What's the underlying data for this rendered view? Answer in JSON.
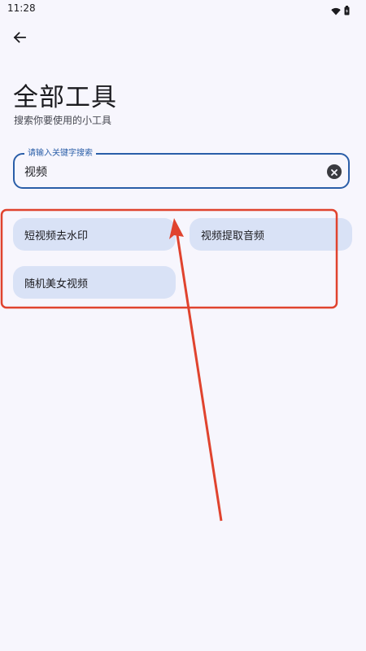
{
  "status_bar": {
    "time": "11:28",
    "icons": [
      "wifi-icon",
      "battery-icon"
    ]
  },
  "header": {
    "back_icon": "arrow-left-icon",
    "title": "全部工具",
    "subtitle": "搜索你要使用的小工具"
  },
  "search": {
    "label": "请输入关键字搜索",
    "value": "视频",
    "clear_icon": "clear-circle-icon",
    "accent_color": "#2a5ea8"
  },
  "results": {
    "items": [
      {
        "label": "短视频去水印"
      },
      {
        "label": "视频提取音频"
      },
      {
        "label": "随机美女视频"
      }
    ],
    "chip_color": "#d9e2f6"
  },
  "annotation": {
    "color": "#e0432e"
  }
}
